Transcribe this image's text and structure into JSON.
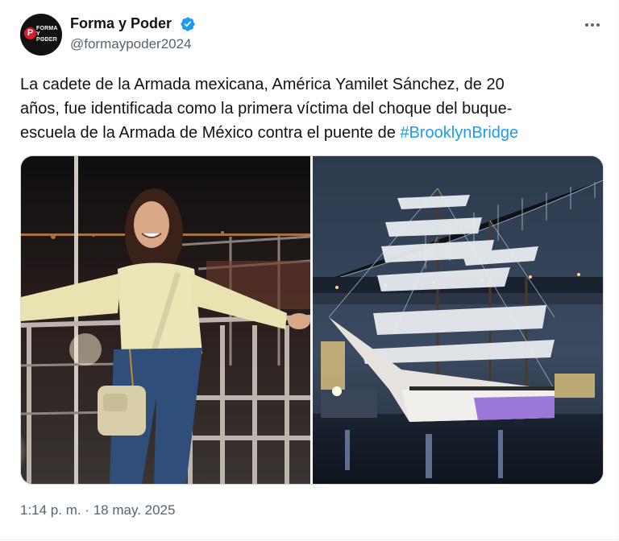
{
  "author": {
    "display_name": "Forma y Poder",
    "handle": "@formaypoder2024",
    "avatar_text": [
      "FORMA",
      "Y",
      "PODER"
    ],
    "avatar_badge": "P",
    "verified": true
  },
  "tweet": {
    "text_before": "La cadete de la Armada mexicana, América Yamilet Sánchez, de 20\naños, fue identificada como la primera víctima del choque del buque-\nescuela de la Armada de México contra el puente de ",
    "hashtag": "#BrooklynBridge",
    "timestamp": "1:14 p. m. · 18 may. 2025"
  },
  "media": {
    "images": [
      {
        "name": "cadet-photo",
        "subject": "young woman in yellow jacket and jeans at night railing"
      },
      {
        "name": "ship-bridge-photo",
        "subject": "tall ship with sails under illuminated bridge at night"
      }
    ]
  },
  "colors": {
    "link": "#1d9bf0",
    "secondary_text": "#536471",
    "verified": "#1d9bf0"
  },
  "icons": [
    "verified-badge-icon",
    "more-options-icon"
  ]
}
